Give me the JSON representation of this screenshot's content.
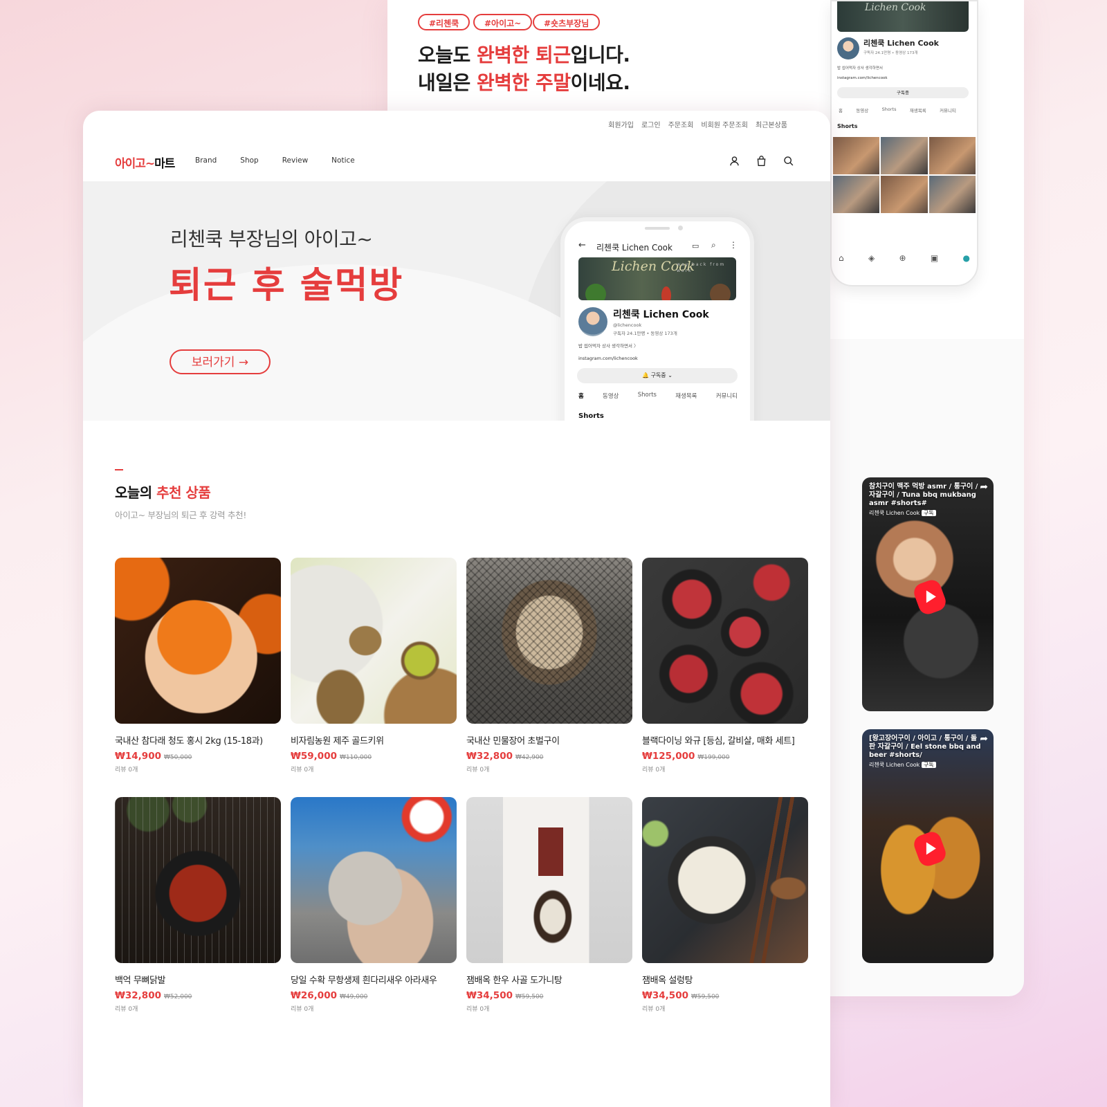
{
  "colors": {
    "accent": "#e53d3d",
    "text": "#222222",
    "muted": "#8a8a8a"
  },
  "bg_panel": {
    "tags": [
      "#리첸쿡",
      "#아이고~",
      "#숏츠부장님"
    ],
    "headline": {
      "line1_a": "오늘도 ",
      "line1_red": "완벽한 퇴근",
      "line1_b": "입니다.",
      "line2_a": "내일은 ",
      "line2_red": "완벽한 주말",
      "line2_b": "이네요."
    },
    "phone": {
      "banner": "Lichen Cook",
      "channel_name": "리첸쿡 Lichen Cook",
      "stats": "구독자 24.1만명 • 동영상 173개",
      "desc": "밥 씹어먹자 상사 생각하면서",
      "link": "instagram.com/lichencook",
      "subscribe": "구독중",
      "tabs": [
        "홈",
        "동영상",
        "Shorts",
        "재생목록",
        "커뮤니티"
      ],
      "section": "Shorts"
    },
    "shorts": [
      {
        "caption": "참치구이 맥주 먹방 asmr / 통구이 / 자갈구이 / Tuna bbq mukbang asmr #shorts#",
        "channel": "리첸쿡 Lichen Cook",
        "sub": "구독"
      },
      {
        "caption": "[왕고장어구이 / 아이고 / 통구이 / 돌판 자갈구이 / Eel stone bbq and beer #shorts/",
        "channel": "리첸쿡 Lichen Cook",
        "sub": "구독"
      }
    ]
  },
  "header": {
    "top_links": [
      "회원가입",
      "로그인",
      "주문조회",
      "비회원 주문조회",
      "최근본상품"
    ],
    "logo_red": "아이고~",
    "logo_black": "마트",
    "nav": [
      "Brand",
      "Shop",
      "Review",
      "Notice"
    ],
    "icons": [
      "user-icon",
      "bag-icon",
      "search-icon"
    ]
  },
  "hero": {
    "subtitle": "리첸쿡 부장님의 아이고~",
    "title": "퇴근 후 술먹방",
    "button": "보러가기 →",
    "phone": {
      "title": "리첸쿡 Lichen Cook",
      "banner_script": "Lichen Cook",
      "banner_small": "way back from work",
      "name": "리첸쿡 Lichen Cook",
      "handle": "@lichencook",
      "stats": "구독자 24.1만명 • 동영상 173개",
      "desc": "밥 씹어먹자 상사 생각하면서 〉",
      "link": "instagram.com/lichencook",
      "subscribe": "🔔 구독중 ⌄",
      "tabs": [
        "홈",
        "동영상",
        "Shorts",
        "재생목록",
        "커뮤니티"
      ],
      "section": "Shorts"
    }
  },
  "section": {
    "title_a": "오늘의 ",
    "title_red": "추천 상품",
    "subtitle": "아이고~ 부장님의 퇴근 후 강력 추천!"
  },
  "products": [
    {
      "name": "국내산 참다래 청도 홍시 2kg (15-18과)",
      "price": "₩14,900",
      "orig": "₩50,000",
      "reviews": "리뷰 0개",
      "image": "persimmon"
    },
    {
      "name": "비자림농원 제주 골드키위",
      "price": "₩59,000",
      "orig": "₩110,000",
      "reviews": "리뷰 0개",
      "image": "kiwi"
    },
    {
      "name": "국내산 민물장어 초벌구이",
      "price": "₩32,800",
      "orig": "₩42,900",
      "reviews": "리뷰 0개",
      "image": "grilled-eel"
    },
    {
      "name": "블랙다이닝 와규 [등심, 갈비살, 매화 세트]",
      "price": "₩125,000",
      "orig": "₩199,000",
      "reviews": "리뷰 0개",
      "image": "wagyu"
    },
    {
      "name": "백억 무뼈닭발",
      "price": "₩32,800",
      "orig": "₩52,000",
      "reviews": "리뷰 0개",
      "image": "chicken-feet"
    },
    {
      "name": "당일 수확 무항생제 흰다리새우 아라새우",
      "price": "₩26,000",
      "orig": "₩49,000",
      "reviews": "리뷰 0개",
      "image": "shrimp"
    },
    {
      "name": "잼배옥 한우 사골 도가니탕",
      "price": "₩34,500",
      "orig": "₩59,500",
      "reviews": "리뷰 0개",
      "image": "soup-package"
    },
    {
      "name": "잼배옥 설렁탕",
      "price": "₩34,500",
      "orig": "₩59,500",
      "reviews": "리뷰 0개",
      "image": "seolleongtang"
    }
  ]
}
